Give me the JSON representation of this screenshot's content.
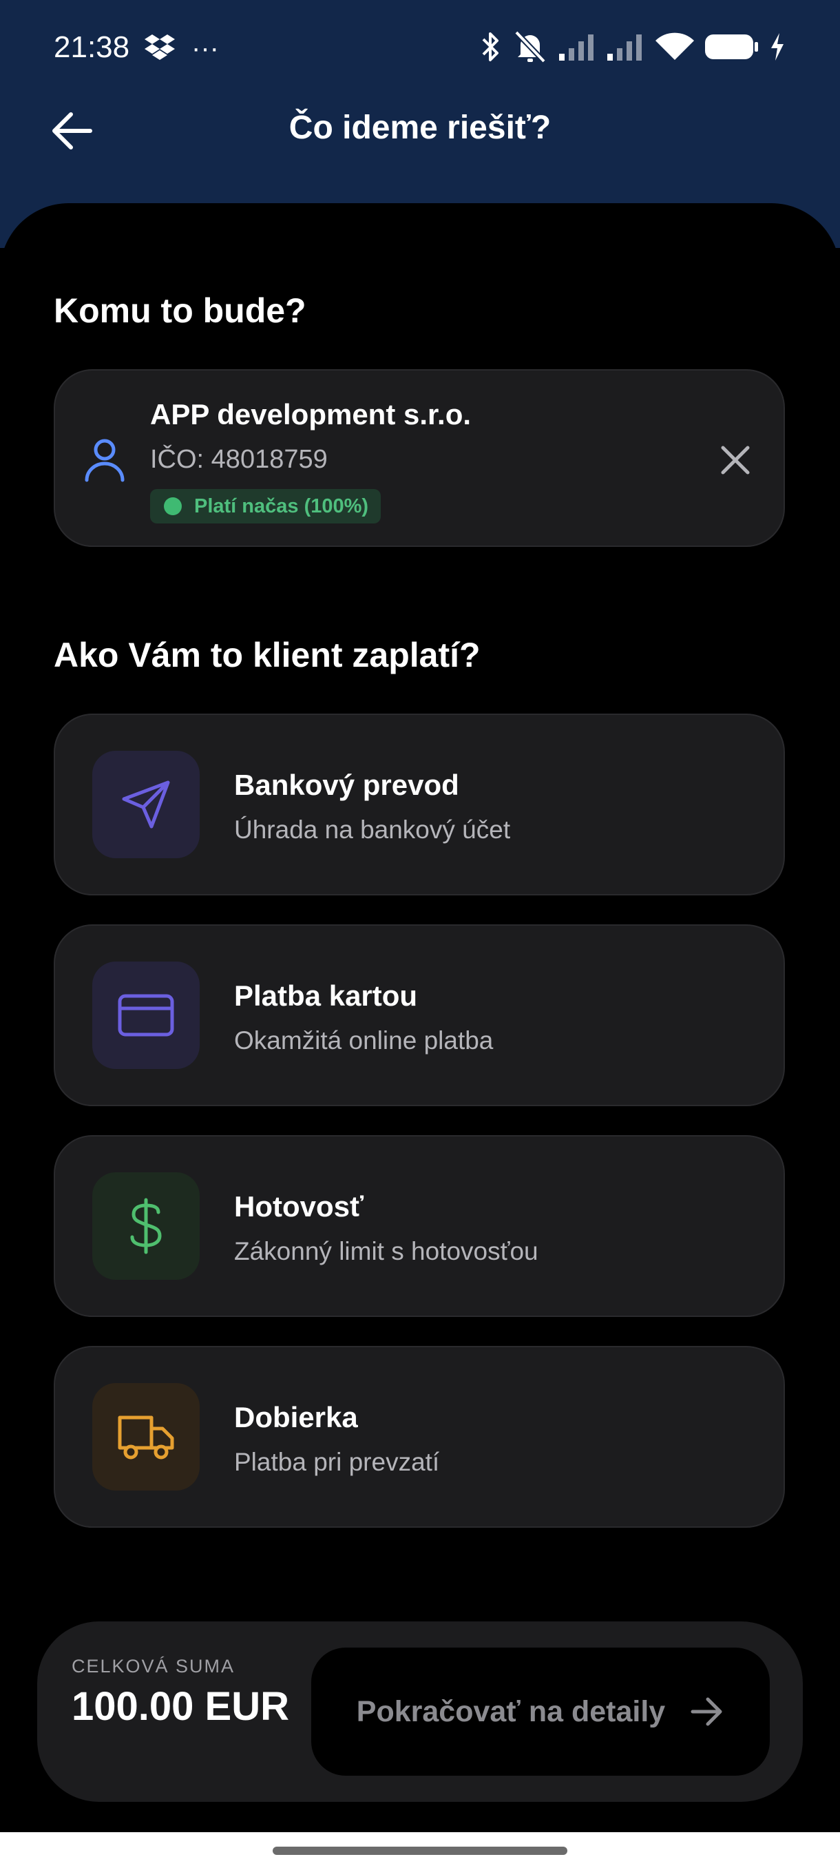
{
  "status_bar": {
    "time": "21:38",
    "more": "···"
  },
  "header": {
    "title": "Čo ideme riešiť?"
  },
  "client_section": {
    "title": "Komu to bude?",
    "client": {
      "name": "APP development s.r.o.",
      "ico": "IČO: 48018759",
      "badge": "Platí načas (100%)"
    }
  },
  "payment_section": {
    "title": "Ako Vám to klient zaplatí?",
    "options": [
      {
        "title": "Bankový prevod",
        "subtitle": "Úhrada na bankový účet",
        "icon": "send-icon",
        "color": "#6b5fe0"
      },
      {
        "title": "Platba kartou",
        "subtitle": "Okamžitá online platba",
        "icon": "credit-card-icon",
        "color": "#6b5fe0"
      },
      {
        "title": "Hotovosť",
        "subtitle": "Zákonný limit s hotovosťou",
        "icon": "dollar-icon",
        "color": "#4fbf6e"
      },
      {
        "title": "Dobierka",
        "subtitle": "Platba pri prevzatí",
        "icon": "truck-icon",
        "color": "#e6a030"
      }
    ]
  },
  "footer": {
    "total_label": "CELKOVÁ SUMA",
    "total_amount": "100.00 EUR",
    "continue_label": "Pokračovať na detaily"
  },
  "colors": {
    "header_bg": "#12274a",
    "card_bg": "#1c1c1e",
    "success": "#3fba72",
    "accent": "#6b5fe0"
  }
}
